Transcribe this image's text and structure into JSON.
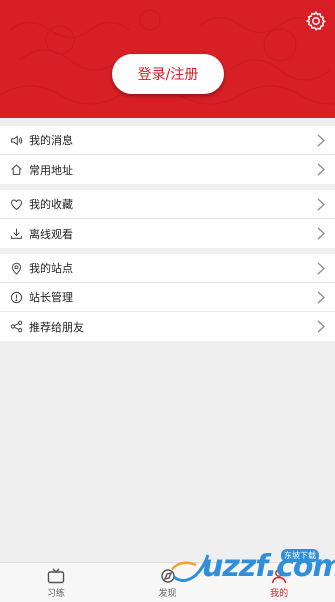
{
  "header": {
    "login_label": "登录/注册",
    "settings_icon": "gear-icon",
    "brand_color": "#d81f26"
  },
  "menu": {
    "group1": [
      {
        "label": "我的消息",
        "icon": "speaker-icon"
      },
      {
        "label": "常用地址",
        "icon": "home-icon"
      }
    ],
    "group2": [
      {
        "label": "我的收藏",
        "icon": "heart-icon"
      },
      {
        "label": "离线观看",
        "icon": "download-icon"
      }
    ],
    "group3": [
      {
        "label": "我的站点",
        "icon": "location-pin-icon"
      },
      {
        "label": "站长管理",
        "icon": "badge-icon"
      },
      {
        "label": "推荐给朋友",
        "icon": "share-icon"
      }
    ]
  },
  "tabbar": {
    "tabs": [
      {
        "label": "习练",
        "icon": "tv-icon"
      },
      {
        "label": "发现",
        "icon": "discover-icon"
      },
      {
        "label": "我的",
        "icon": "user-icon",
        "active": true
      }
    ]
  },
  "watermark": {
    "text": "uzzf.com",
    "badge": "东坡下载"
  }
}
